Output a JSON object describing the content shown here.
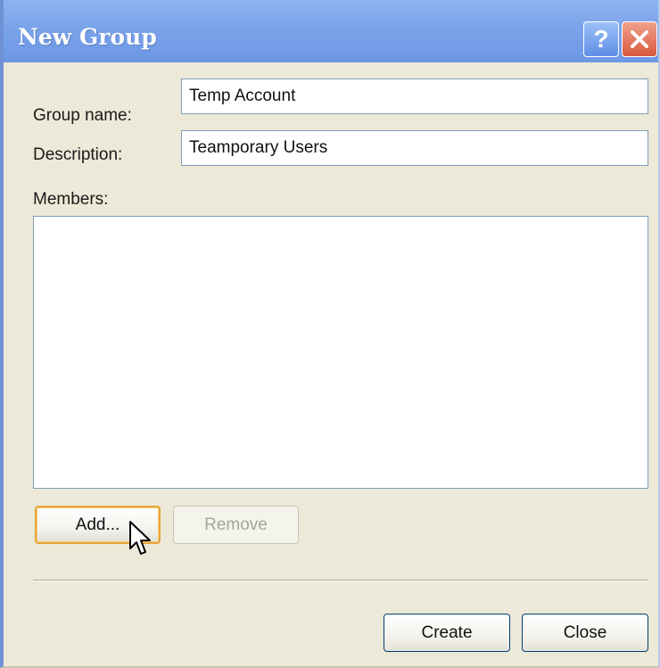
{
  "window": {
    "title": "New Group",
    "help_icon": "help-icon",
    "help_glyph": "?",
    "close_icon": "close-icon"
  },
  "form": {
    "group_name": {
      "label": "Group name:",
      "value": "Temp Account"
    },
    "description": {
      "label": "Description:",
      "value": "Teamporary Users"
    },
    "members": {
      "label": "Members:",
      "items": []
    }
  },
  "buttons": {
    "add": "Add...",
    "remove": "Remove",
    "create": "Create",
    "close": "Close"
  },
  "cursor": {
    "icon": "mouse-pointer-icon"
  },
  "colors": {
    "titlebar": "#7aa3ea",
    "dialog_background": "#ece9d8",
    "close_button": "#d9583c",
    "focus_ring": "#e8a33c"
  }
}
